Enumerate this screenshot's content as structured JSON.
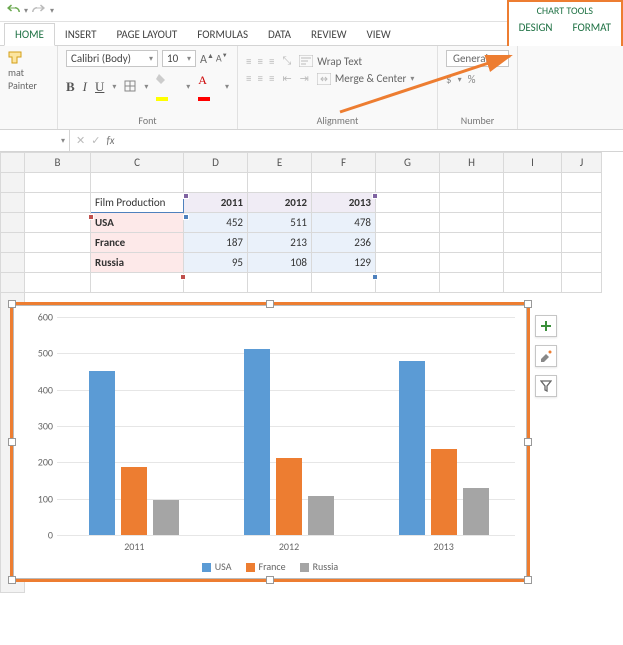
{
  "qat": {
    "undo_icon": "undo",
    "redo_icon": "redo"
  },
  "tabs": {
    "home": "HOME",
    "insert": "INSERT",
    "page_layout": "PAGE LAYOUT",
    "formulas": "FORMULAS",
    "data": "DATA",
    "review": "REVIEW",
    "view": "VIEW"
  },
  "chart_tools": {
    "title": "CHART TOOLS",
    "design": "DESIGN",
    "format": "FORMAT"
  },
  "ribbon": {
    "clipboard": {
      "format_painter": "mat Painter"
    },
    "font": {
      "group_label": "Font",
      "name": "Calibri (Body)",
      "size": "10",
      "bold": "B",
      "italic": "I",
      "underline": "U",
      "grow": "A",
      "shrink": "A",
      "fill_color": "#ffff00",
      "font_color": "#ff0000"
    },
    "alignment": {
      "group_label": "Alignment",
      "wrap": "Wrap Text",
      "merge": "Merge & Center"
    },
    "number": {
      "group_label": "Number",
      "format": "General",
      "currency": "$"
    }
  },
  "formula_bar": {
    "fx": "fx"
  },
  "columns": [
    "B",
    "C",
    "D",
    "E",
    "F",
    "G",
    "H",
    "I",
    "J"
  ],
  "table": {
    "title": "Film Production",
    "years": [
      "2011",
      "2012",
      "2013"
    ],
    "rows": [
      {
        "label": "USA",
        "values": [
          "452",
          "511",
          "478"
        ]
      },
      {
        "label": "France",
        "values": [
          "187",
          "213",
          "236"
        ]
      },
      {
        "label": "Russia",
        "values": [
          "95",
          "108",
          "129"
        ]
      }
    ]
  },
  "chart_data": {
    "type": "bar",
    "categories": [
      "2011",
      "2012",
      "2013"
    ],
    "series": [
      {
        "name": "USA",
        "values": [
          452,
          511,
          478
        ],
        "color": "#5b9bd5"
      },
      {
        "name": "France",
        "values": [
          187,
          213,
          236
        ],
        "color": "#ed7d31"
      },
      {
        "name": "Russia",
        "values": [
          95,
          108,
          129
        ],
        "color": "#a5a5a5"
      }
    ],
    "ylim": [
      0,
      600
    ],
    "yticks": [
      0,
      100,
      200,
      300,
      400,
      500,
      600
    ],
    "xlabel": "",
    "ylabel": "",
    "title": ""
  },
  "side_buttons": {
    "add": "+",
    "brush": "brush",
    "filter": "filter"
  }
}
